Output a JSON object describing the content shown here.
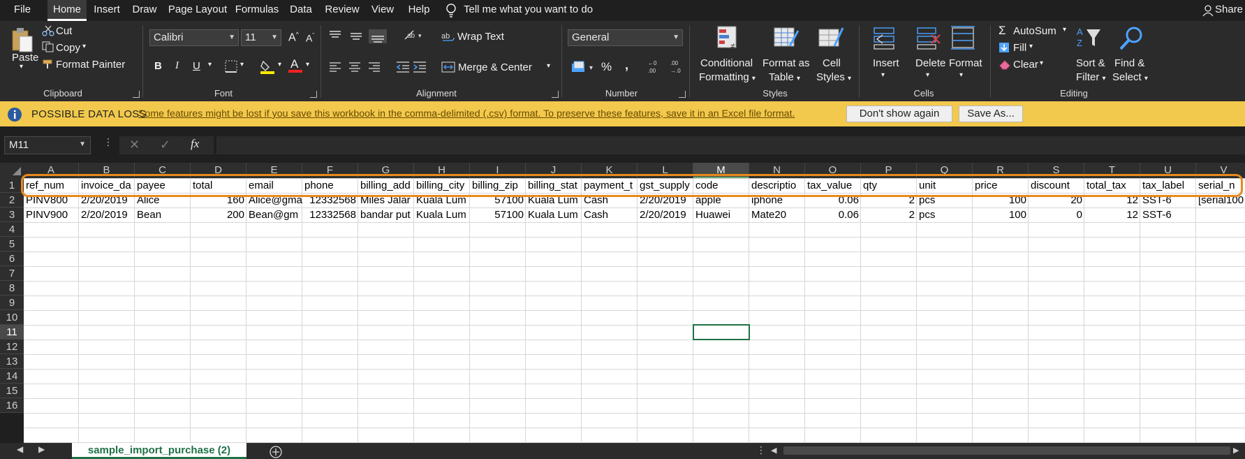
{
  "menu": {
    "tabs": [
      "File",
      "Home",
      "Insert",
      "Draw",
      "Page Layout",
      "Formulas",
      "Data",
      "Review",
      "View",
      "Help"
    ],
    "active": "Home",
    "tell_me": "Tell me what you want to do",
    "share": "Share"
  },
  "ribbon": {
    "clipboard": {
      "paste": "Paste",
      "cut": "Cut",
      "copy": "Copy",
      "format_painter": "Format Painter",
      "label": "Clipboard"
    },
    "font": {
      "name": "Calibri",
      "size": "11",
      "bold": "B",
      "italic": "I",
      "underline": "U",
      "label": "Font",
      "grow": "A",
      "shrink": "A",
      "font_color_letter": "A"
    },
    "alignment": {
      "wrap_text": "Wrap Text",
      "merge_center": "Merge & Center",
      "label": "Alignment"
    },
    "number": {
      "format": "General",
      "percent": "%",
      "comma": ",",
      "label": "Number"
    },
    "styles": {
      "conditional": "Conditional",
      "formatting": "Formatting",
      "format_as": "Format as",
      "table": "Table",
      "cell": "Cell",
      "styles": "Styles",
      "label": "Styles"
    },
    "cells": {
      "insert": "Insert",
      "delete": "Delete",
      "format": "Format",
      "label": "Cells"
    },
    "editing": {
      "autosum": "AutoSum",
      "fill": "Fill",
      "clear": "Clear",
      "sort": "Sort &",
      "filter": "Filter",
      "find": "Find &",
      "select": "Select",
      "label": "Editing"
    }
  },
  "infobar": {
    "title": "POSSIBLE DATA LOSS",
    "message": "Some features might be lost if you save this workbook in the comma-delimited (.csv) format. To preserve these features, save it in an Excel file format.",
    "dont_show": "Don't show again",
    "save_as": "Save As..."
  },
  "formula_bar": {
    "name_box": "M11",
    "fx": "fx",
    "value": ""
  },
  "grid": {
    "columns": [
      "A",
      "B",
      "C",
      "D",
      "E",
      "F",
      "G",
      "H",
      "I",
      "J",
      "K",
      "L",
      "M",
      "N",
      "O",
      "P",
      "Q",
      "R",
      "S",
      "T",
      "U",
      "V"
    ],
    "rows": [
      "1",
      "2",
      "3",
      "4",
      "5",
      "6",
      "7",
      "8",
      "9",
      "10",
      "11",
      "12",
      "13",
      "14",
      "15",
      "16"
    ],
    "selected_col": "M",
    "selected_row": "11",
    "row1": [
      "ref_num",
      "invoice_da",
      "payee",
      "total",
      "email",
      "phone",
      "billing_add",
      "billing_city",
      "billing_zip",
      "billing_stat",
      "payment_t",
      "gst_supply",
      "code",
      "descriptio",
      "tax_value",
      "qty",
      "unit",
      "price",
      "discount",
      "total_tax",
      "tax_label",
      "serial_n"
    ],
    "row2": [
      "PINV800",
      "2/20/2019",
      "Alice",
      "160",
      "Alice@gma",
      "12332568",
      "Miles Jalar",
      "Kuala Lum",
      "57100",
      "Kuala Lum",
      "Cash",
      "2/20/2019",
      "apple",
      "iphone",
      "0.06",
      "2",
      "pcs",
      "100",
      "20",
      "12",
      "SST-6",
      "[serial100"
    ],
    "row3": [
      "PINV900",
      "2/20/2019",
      "Bean",
      "200",
      "Bean@gm",
      "12332568",
      "bandar put",
      "Kuala Lum",
      "57100",
      "Kuala Lum",
      "Cash",
      "2/20/2019",
      "Huawei",
      "Mate20",
      "0.06",
      "2",
      "pcs",
      "100",
      "0",
      "12",
      "SST-6",
      ""
    ]
  },
  "sheet": {
    "tab_name": "sample_import_purchase (2)"
  }
}
